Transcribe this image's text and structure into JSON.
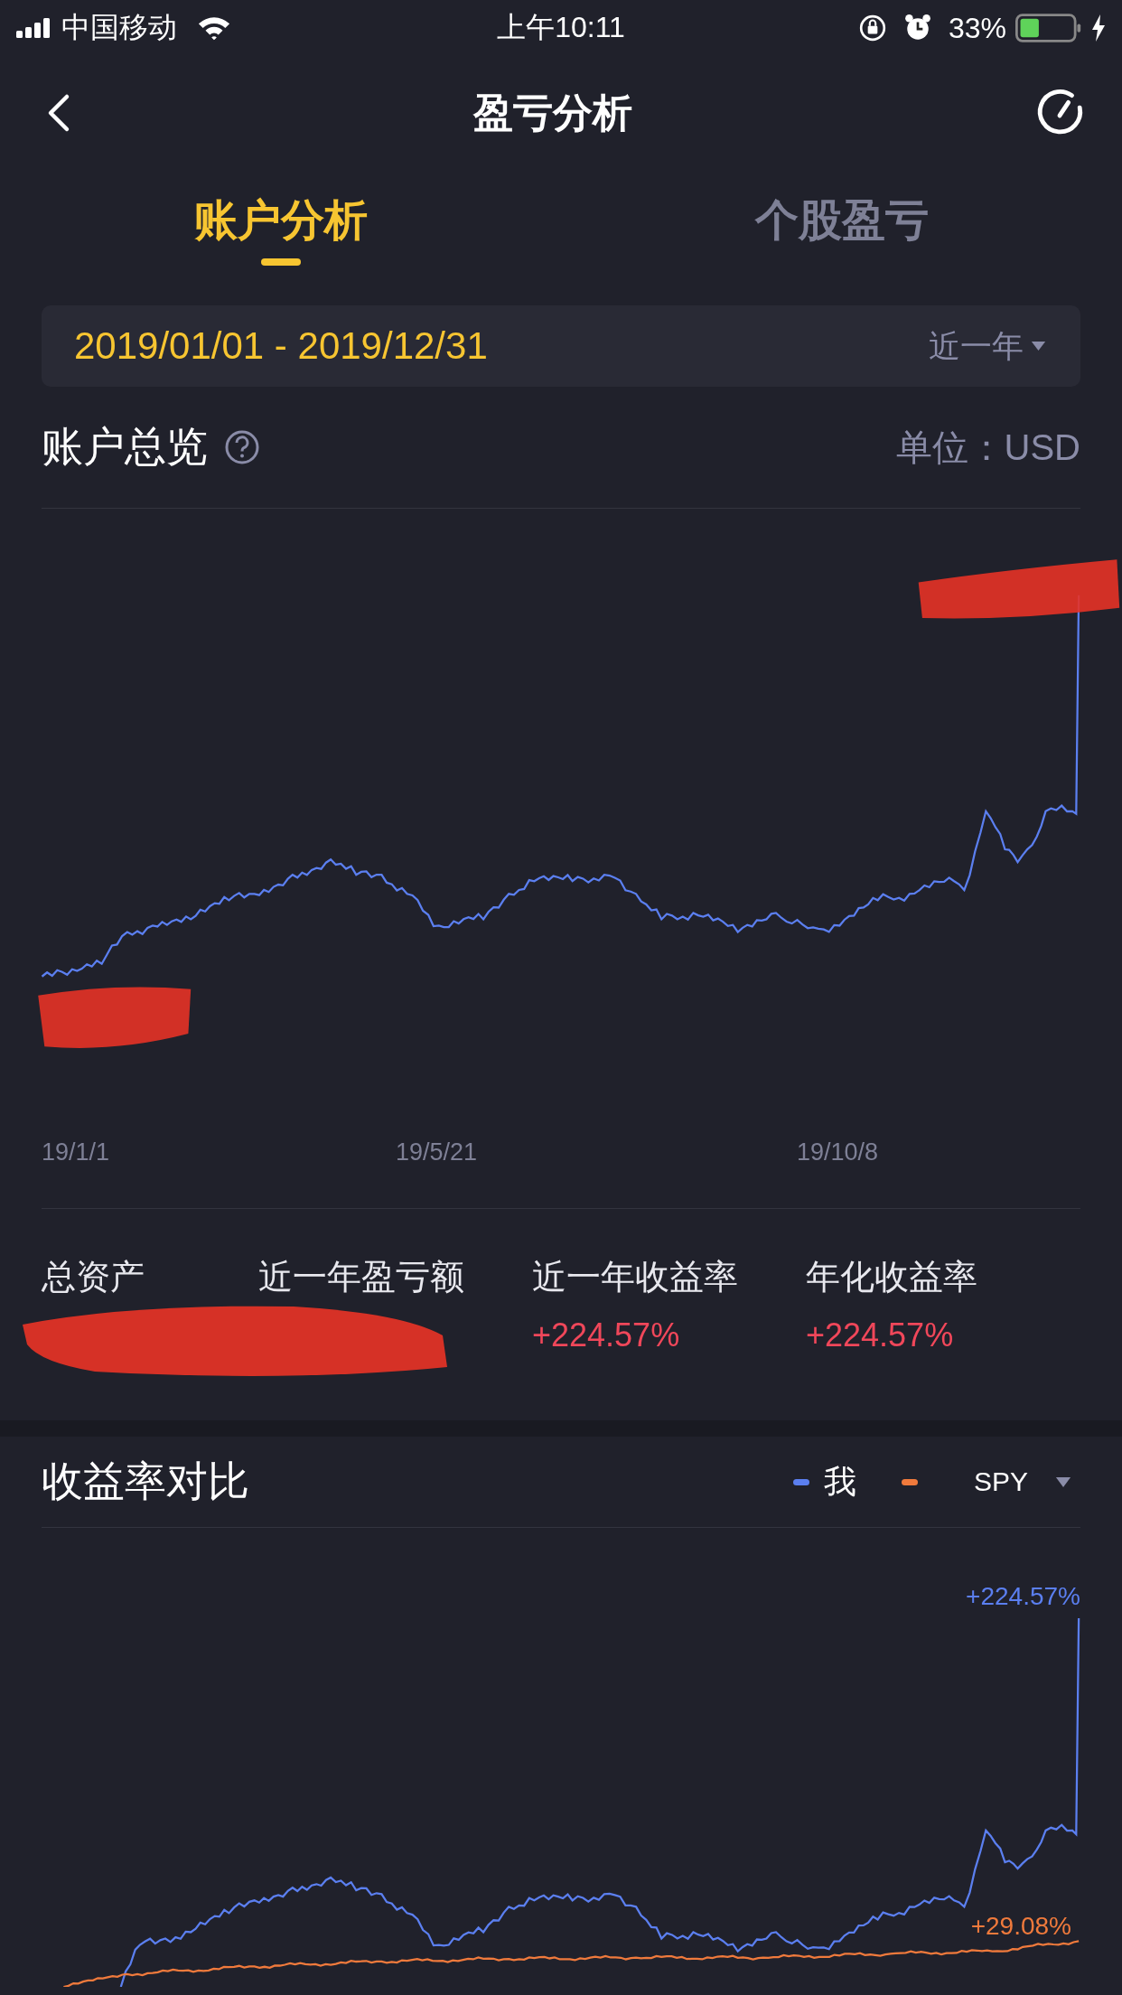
{
  "status_bar": {
    "carrier": "中国移动",
    "time": "上午10:11",
    "battery": "33%"
  },
  "header": {
    "title": "盈亏分析"
  },
  "tabs": [
    {
      "label": "账户分析",
      "selected": true
    },
    {
      "label": "个股盈亏",
      "selected": false
    }
  ],
  "date_range": {
    "value": "2019/01/01 - 2019/12/31",
    "period": "近一年"
  },
  "overview": {
    "title": "账户总览",
    "unit": "单位：USD",
    "x_labels": [
      "19/1/1",
      "19/5/21",
      "19/10/8"
    ],
    "stats": [
      {
        "label": "总资产"
      },
      {
        "label": "近一年盈亏额"
      },
      {
        "label": "近一年收益率",
        "value": "+224.57%"
      },
      {
        "label": "年化收益率",
        "value": "+224.57%"
      }
    ]
  },
  "comparison": {
    "title": "收益率对比",
    "legend": [
      {
        "label": "我",
        "color": "#5b7ff0"
      },
      {
        "color": "#f07a3c"
      }
    ],
    "benchmark": "SPY",
    "my_return": "+224.57%",
    "benchmark_return": "+29.08%"
  }
}
